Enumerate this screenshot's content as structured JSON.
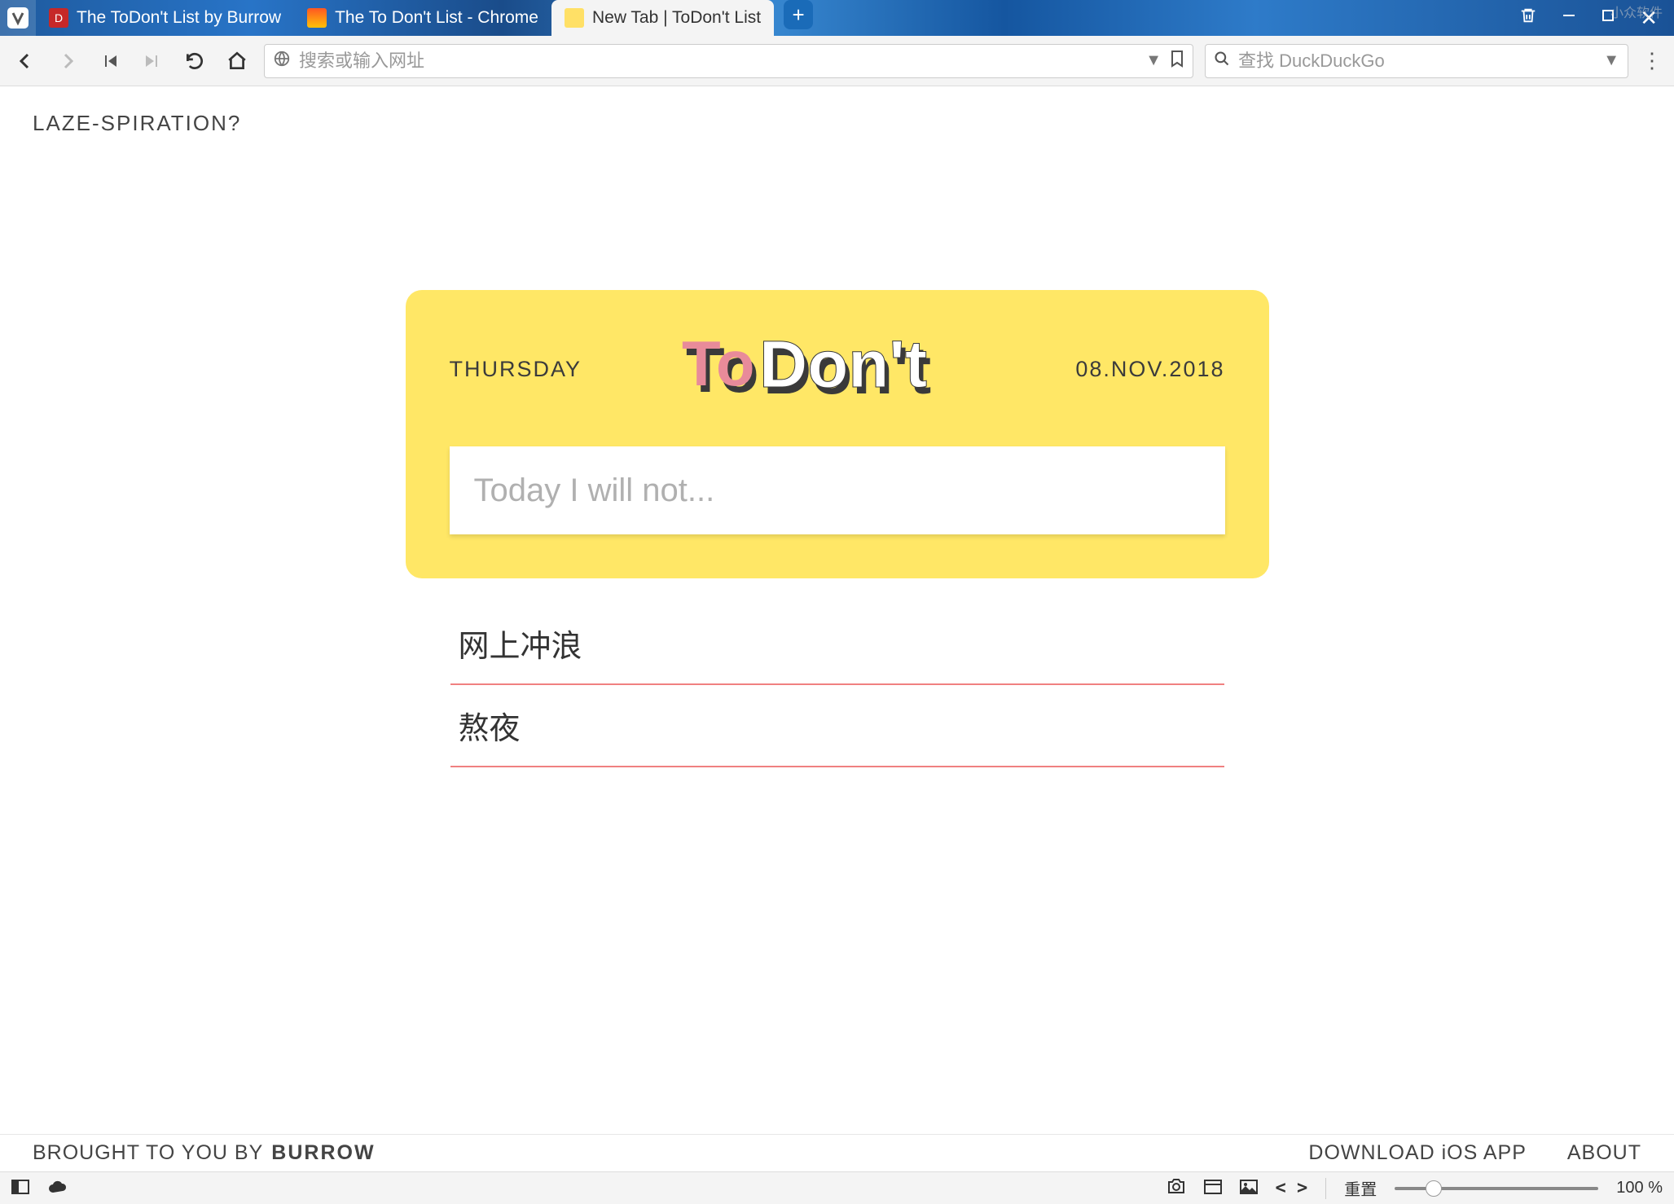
{
  "window": {
    "watermark": "小众软件",
    "tabs": [
      {
        "label": "The ToDon't List by Burrow",
        "active": false
      },
      {
        "label": "The To Don't List - Chrome",
        "active": false
      },
      {
        "label": "New Tab | ToDon't List",
        "active": true
      }
    ]
  },
  "toolbar": {
    "address_placeholder": "搜索或输入网址",
    "search_placeholder": "查找 DuckDuckGo"
  },
  "page": {
    "top_link": "LAZE-SPIRATION?",
    "card": {
      "day": "THURSDAY",
      "date": "08.NOV.2018",
      "logo_text_to": "To",
      "logo_text_dont": "Don't",
      "input_placeholder": "Today I will not..."
    },
    "items": [
      "网上冲浪",
      "熬夜"
    ],
    "footer": {
      "brought": "BROUGHT TO YOU BY",
      "brand": "BURROW",
      "download": "DOWNLOAD iOS APP",
      "about": "ABOUT"
    }
  },
  "statusbar": {
    "reset_label": "重置",
    "zoom_label": "100 %"
  }
}
